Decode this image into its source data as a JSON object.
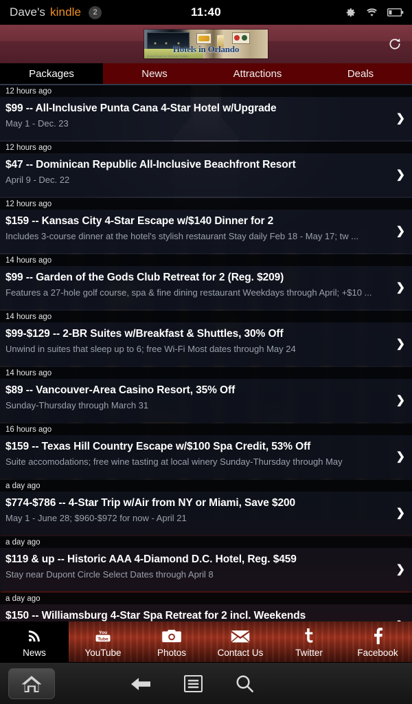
{
  "statusbar": {
    "owner": "Dave's",
    "brand": "kindle",
    "badge": "2",
    "clock": "11:40",
    "icons": [
      "gear-icon",
      "wifi-icon",
      "battery-low-icon"
    ]
  },
  "header": {
    "ad_title": "Hotels in Orlando",
    "ad_subtitle": "Great Deals on Orlando Hotels",
    "refresh_label": "Refresh"
  },
  "tabs": [
    {
      "label": "Packages",
      "active": true
    },
    {
      "label": "News",
      "active": false
    },
    {
      "label": "Attractions",
      "active": false
    },
    {
      "label": "Deals",
      "active": false
    }
  ],
  "deals": [
    {
      "time": "12 hours ago",
      "title": "$99 -- All-Inclusive Punta Cana 4-Star Hotel w/Upgrade",
      "desc": "May 1 - Dec. 23"
    },
    {
      "time": "12 hours ago",
      "title": "$47 -- Dominican Republic All-Inclusive Beachfront Resort",
      "desc": "April 9 - Dec. 22"
    },
    {
      "time": "12 hours ago",
      "title": "$159 -- Kansas City 4-Star Escape w/$140 Dinner for 2",
      "desc": "Includes 3-course dinner at the hotel's stylish restaurant Stay daily Feb 18 - May 17; tw ..."
    },
    {
      "time": "14 hours ago",
      "title": "$99 -- Garden of the Gods Club Retreat for 2 (Reg. $209)",
      "desc": "Features a 27-hole golf course, spa & fine dining restaurant Weekdays through April; +$10 ..."
    },
    {
      "time": "14 hours ago",
      "title": "$99-$129 -- 2-BR Suites w/Breakfast & Shuttles, 30% Off",
      "desc": "Unwind in suites that sleep up to 6; free Wi-Fi Most dates through May 24"
    },
    {
      "time": "14 hours ago",
      "title": "$89 -- Vancouver-Area Casino Resort, 35% Off",
      "desc": "Sunday-Thursday through March 31"
    },
    {
      "time": "16 hours ago",
      "title": "$159 -- Texas Hill Country Escape w/$100 Spa Credit, 53% Off",
      "desc": "Suite accomodations; free wine tasting at local winery Sunday-Thursday through May"
    },
    {
      "time": "a day ago",
      "title": "$774-$786 -- 4-Star Trip w/Air from NY or Miami, Save $200",
      "desc": "May 1 - June 28; $960-$972 for now - April 21"
    },
    {
      "time": "a day ago",
      "title": "$119 & up -- Historic AAA 4-Diamond D.C. Hotel, Reg. $459",
      "desc": "Stay near Dupont Circle Select Dates through April 8"
    },
    {
      "time": "a day ago",
      "title": "$150 -- Williamsburg 4-Star Spa Retreat for 2 incl. Weekends",
      "desc": ""
    }
  ],
  "chevron": "❯",
  "socialnav": [
    {
      "label": "News",
      "icon": "rss-icon",
      "active": true
    },
    {
      "label": "YouTube",
      "icon": "youtube-icon",
      "active": false
    },
    {
      "label": "Photos",
      "icon": "camera-icon",
      "active": false
    },
    {
      "label": "Contact Us",
      "icon": "envelope-icon",
      "active": false
    },
    {
      "label": "Twitter",
      "icon": "twitter-icon",
      "active": false
    },
    {
      "label": "Facebook",
      "icon": "facebook-icon",
      "active": false
    }
  ],
  "sysnav": {
    "home": "Home",
    "back": "Back",
    "menu": "Menu",
    "search": "Search"
  },
  "colors": {
    "brand_orange": "#ef8f23",
    "tab_inactive_bg": "#5a0203",
    "tab_active_bg": "#000000",
    "header_maroon": "#6e2f39",
    "social_red": "#a8351f",
    "row_bg": "rgba(14,17,27,.80)"
  }
}
